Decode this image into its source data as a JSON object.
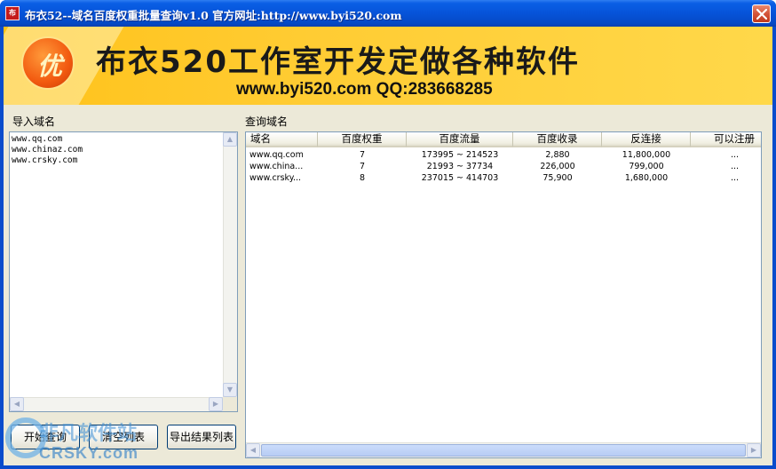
{
  "window": {
    "title": "布衣52--域名百度权重批量查询v1.0  官方网址:http://www.byi520.com",
    "icon": "app-icon"
  },
  "banner": {
    "badge": "优",
    "title": "布衣520工作室开发定做各种软件",
    "subtitle": "www.byi520.com QQ:283668285"
  },
  "import": {
    "label": "导入域名",
    "lines": [
      "www.qq.com",
      "www.chinaz.com",
      "www.crsky.com"
    ]
  },
  "buttons": {
    "start": "开始查询",
    "clear": "清空列表",
    "export": "导出结果列表"
  },
  "results": {
    "label": "查询域名",
    "columns": [
      "域名",
      "百度权重",
      "百度流量",
      "百度收录",
      "反连接",
      "可以注册"
    ],
    "rows": [
      [
        "www.qq.com",
        "7",
        "173995 ~ 214523",
        "2,880",
        "11,800,000",
        "..."
      ],
      [
        "www.china...",
        "7",
        "21993 ~ 37734",
        "226,000",
        "799,000",
        "..."
      ],
      [
        "www.crsky...",
        "8",
        "237015 ~ 414703",
        "75,900",
        "1,680,000",
        "..."
      ]
    ]
  },
  "watermark": {
    "line1": "非凡软件站",
    "line2": "CRSKY.com"
  },
  "colors": {
    "titlebar": "#0653d9",
    "banner": "#ffcc33",
    "face": "#ece9d8"
  }
}
